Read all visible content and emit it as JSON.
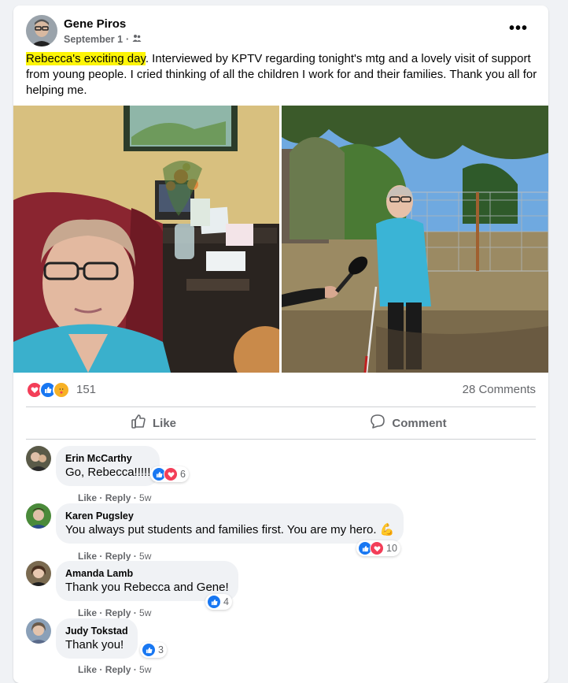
{
  "post": {
    "author": "Gene Piros",
    "date": "September 1",
    "audience_icon": "friends-icon",
    "highlighted_text": "Rebecca's exciting day",
    "body_text": ".   Interviewed by KPTV regarding tonight's mtg and a lovely visit of support from young people.  I cried thinking of all the children I work for and their families.   Thank you all for helping me.",
    "highlight_color": "#fdf506"
  },
  "reactions": {
    "icons": [
      "love-icon",
      "like-icon",
      "care-icon"
    ],
    "count": "151",
    "comments_count": "28 Comments"
  },
  "actions": {
    "like": "Like",
    "comment": "Comment"
  },
  "comments": [
    {
      "name": "Erin McCarthy",
      "text": "Go, Rebecca!!!!!",
      "react_count": "6",
      "like": "Like",
      "reply": "Reply",
      "time": "5w"
    },
    {
      "name": "Karen Pugsley",
      "text": "You always put students and families first. You are my hero. 💪",
      "react_count": "10",
      "like": "Like",
      "reply": "Reply",
      "time": "5w"
    },
    {
      "name": "Amanda Lamb",
      "text": "Thank you Rebecca and Gene!",
      "react_count": "4",
      "like": "Like",
      "reply": "Reply",
      "time": "5w"
    },
    {
      "name": "Judy Tokstad",
      "text": "Thank you!",
      "react_count": "3",
      "like": "Like",
      "reply": "Reply",
      "time": "5w"
    }
  ],
  "colors": {
    "like_blue": "#1877f2",
    "love_red": "#f33e58",
    "care_yellow": "#f7b125",
    "secondary_text": "#65676b"
  }
}
